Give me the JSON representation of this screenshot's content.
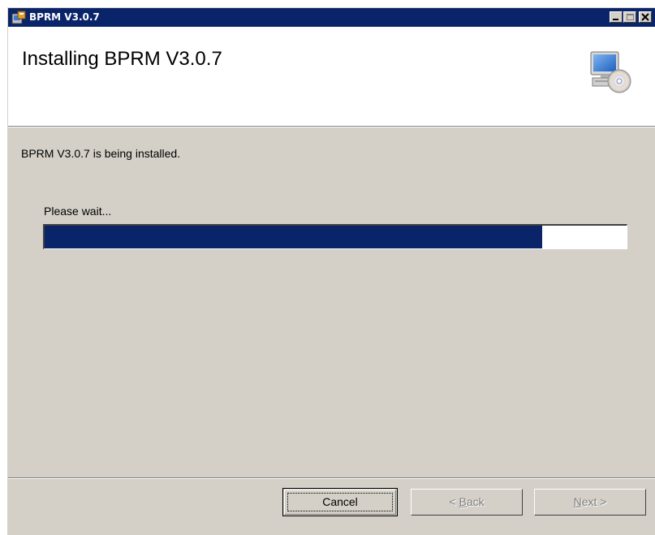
{
  "window": {
    "title": "BPRM V3.0.7",
    "controls": [
      "minimize-icon",
      "maximize-icon",
      "close-icon"
    ]
  },
  "header": {
    "title": "Installing BPRM V3.0.7",
    "icon": "computer-cd-icon"
  },
  "body": {
    "status_text": "BPRM V3.0.7 is being installed.",
    "wait_label": "Please wait...",
    "progress_fraction": 0.855
  },
  "buttons": {
    "cancel": {
      "label": "Cancel",
      "enabled": true,
      "focused": true
    },
    "back": {
      "prefix": "< ",
      "mnemonic": "B",
      "rest": "ack",
      "enabled": false
    },
    "next": {
      "prefix": "",
      "mnemonic": "N",
      "rest": "ext >",
      "enabled": false
    }
  },
  "colors": {
    "title_bar": "#0a246a",
    "progress_fill": "#0a246a",
    "dialog_face": "#d4d0c8"
  }
}
